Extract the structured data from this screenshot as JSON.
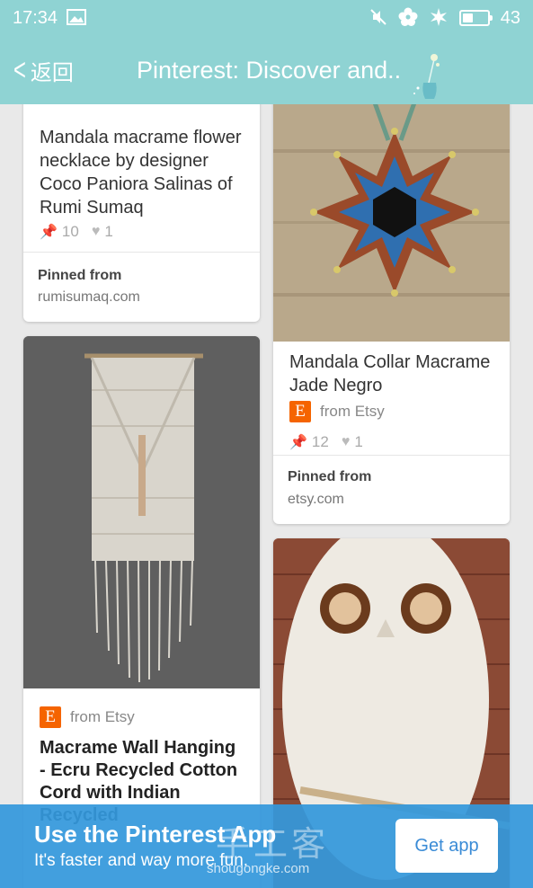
{
  "status_bar": {
    "time": "17:34",
    "battery": "43",
    "battery_level": 0.43
  },
  "header": {
    "back_label": "返回",
    "title": "Pinterest: Discover and.."
  },
  "pins": [
    {
      "title": "Mandala macrame flower necklace by designer Coco Paniora Salinas of Rumi Sumaq",
      "repins": "10",
      "likes": "1",
      "pinned_from_label": "Pinned from",
      "pinned_from_source": "rumisumaq.com"
    },
    {
      "title": "Mandala Collar Macrame Jade Negro",
      "source_label": "from Etsy",
      "repins": "12",
      "likes": "1",
      "pinned_from_label": "Pinned from",
      "pinned_from_source": "etsy.com"
    },
    {
      "source_label": "from Etsy",
      "title": "Macrame Wall Hanging - Ecru Recycled Cotton Cord with Indian Recycled"
    }
  ],
  "etsy_logo_letter": "E",
  "banner": {
    "title": "Use the Pinterest App",
    "subtitle": "It's faster and way more fun.",
    "button_label": "Get app"
  },
  "watermark": {
    "chinese": "手工客",
    "url": "shougongke.com"
  },
  "colors": {
    "header": "#8fd3d3",
    "banner": "#3498db",
    "etsy": "#f56400"
  }
}
